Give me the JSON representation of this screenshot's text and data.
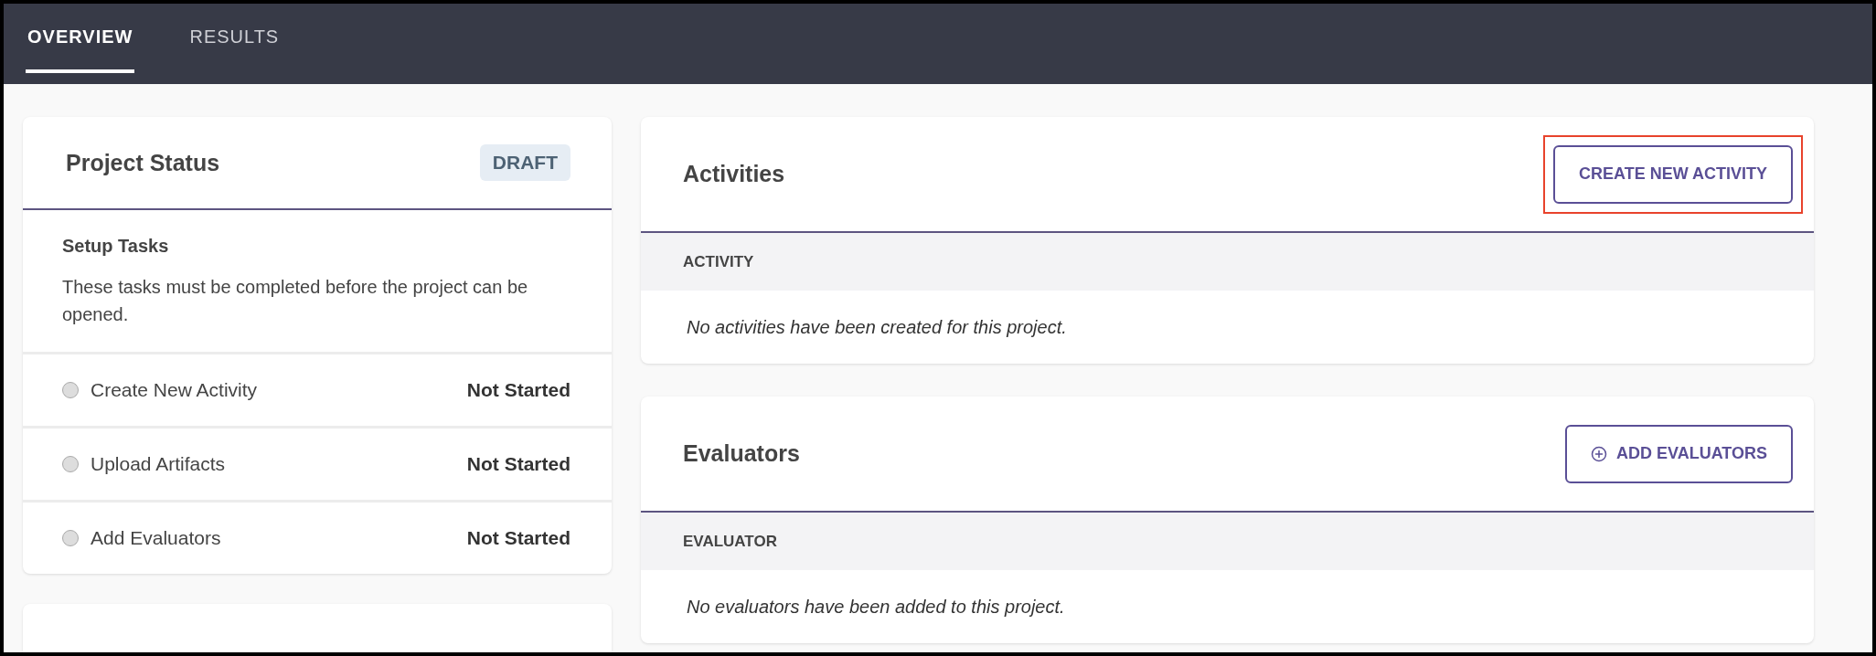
{
  "tabs": [
    {
      "label": "OVERVIEW",
      "selected": true
    },
    {
      "label": "RESULTS",
      "selected": false
    }
  ],
  "project_status": {
    "title": "Project Status",
    "badge": "DRAFT",
    "setup_title": "Setup Tasks",
    "setup_text": "These tasks must be completed before the project can be opened.",
    "tasks": [
      {
        "name": "Create New Activity",
        "status": "Not Started"
      },
      {
        "name": "Upload Artifacts",
        "status": "Not Started"
      },
      {
        "name": "Add Evaluators",
        "status": "Not Started"
      }
    ]
  },
  "sections": [
    {
      "title": "Activities",
      "button": {
        "label": "CREATE NEW ACTIVITY",
        "kind": "text",
        "highlighted": true
      },
      "column": "ACTIVITY",
      "empty_text": "No activities have been created for this project."
    },
    {
      "title": "Evaluators",
      "button": {
        "label": "ADD EVALUATORS",
        "kind": "with-icon",
        "highlighted": false
      },
      "column": "EVALUATOR",
      "empty_text": "No evaluators have been added to this project."
    }
  ]
}
